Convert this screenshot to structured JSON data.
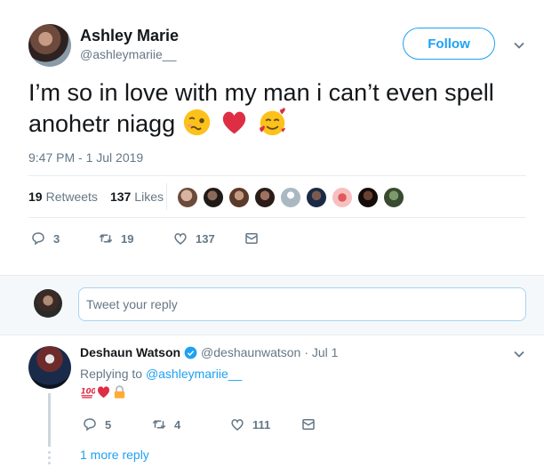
{
  "tweet": {
    "author_name": "Ashley Marie",
    "author_handle": "@ashleymariie__",
    "follow_label": "Follow",
    "text": "I’m so in love with my man i can’t even spell anohetr niagg",
    "emojis": [
      "woozy-face",
      "red-heart",
      "smiling-face-with-hearts"
    ],
    "timestamp": "9:47 PM - 1 Jul 2019",
    "retweets_count": "19",
    "retweets_label": "Retweets",
    "likes_count": "137",
    "likes_label": "Likes",
    "actions": {
      "reply_count": "3",
      "retweet_count": "19",
      "like_count": "137"
    }
  },
  "reply_box": {
    "placeholder": "Tweet your reply"
  },
  "reply": {
    "author_name": "Deshaun Watson",
    "author_handle": "@deshaunwatson",
    "date": "· Jul 1",
    "replying_prefix": "Replying to",
    "replying_to": "@ashleymariie__",
    "emojis": [
      "hundred-points",
      "red-heart",
      "locked"
    ],
    "actions": {
      "reply_count": "5",
      "retweet_count": "4",
      "like_count": "111"
    },
    "more_replies": "1 more reply"
  },
  "colors": {
    "accent": "#1da1f2",
    "text": "#14171a",
    "muted": "#657786",
    "border": "#e6ecf0",
    "heart": "#e0245e"
  }
}
